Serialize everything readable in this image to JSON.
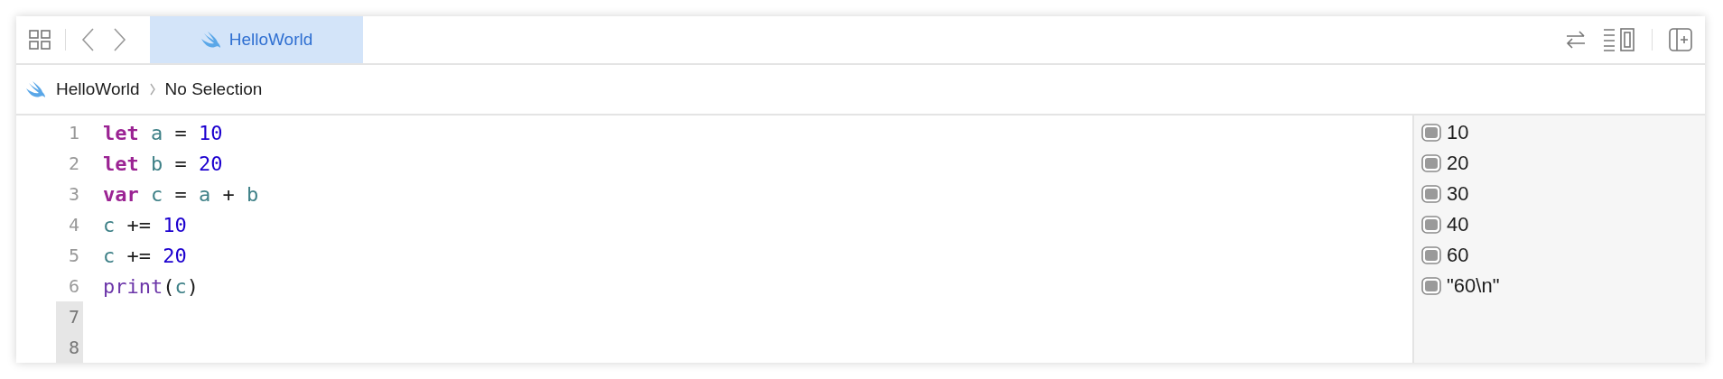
{
  "tab_bar": {
    "tabs": [
      {
        "label": "HelloWorld",
        "selected": true
      }
    ]
  },
  "breadcrumb": {
    "file": "HelloWorld",
    "selection": "No Selection"
  },
  "editor": {
    "lines": [
      {
        "number": "1",
        "highlighted": false,
        "tokens": [
          {
            "kind": "keyword",
            "text": "let"
          },
          {
            "kind": "identifier",
            "text": "a"
          },
          {
            "kind": "plain",
            "text": "="
          },
          {
            "kind": "number",
            "text": "10"
          }
        ]
      },
      {
        "number": "2",
        "highlighted": false,
        "tokens": [
          {
            "kind": "keyword",
            "text": "let"
          },
          {
            "kind": "identifier",
            "text": "b"
          },
          {
            "kind": "plain",
            "text": "="
          },
          {
            "kind": "number",
            "text": "20"
          }
        ]
      },
      {
        "number": "3",
        "highlighted": false,
        "tokens": [
          {
            "kind": "keyword",
            "text": "var"
          },
          {
            "kind": "identifier",
            "text": "c"
          },
          {
            "kind": "plain",
            "text": "="
          },
          {
            "kind": "identifier",
            "text": "a"
          },
          {
            "kind": "plain",
            "text": "+"
          },
          {
            "kind": "identifier",
            "text": "b"
          }
        ]
      },
      {
        "number": "4",
        "highlighted": false,
        "tokens": [
          {
            "kind": "identifier",
            "text": "c"
          },
          {
            "kind": "plain",
            "text": "+="
          },
          {
            "kind": "number",
            "text": "10"
          }
        ]
      },
      {
        "number": "5",
        "highlighted": false,
        "tokens": [
          {
            "kind": "identifier",
            "text": "c"
          },
          {
            "kind": "plain",
            "text": "+="
          },
          {
            "kind": "number",
            "text": "20"
          }
        ]
      },
      {
        "number": "6",
        "highlighted": false,
        "tokens": [
          {
            "kind": "function",
            "text": "print"
          },
          {
            "kind": "plain",
            "text": "("
          },
          {
            "kind": "identifier",
            "text": "c"
          },
          {
            "kind": "plain",
            "text": ")"
          }
        ]
      },
      {
        "number": "7",
        "highlighted": true
      },
      {
        "number": "8",
        "highlighted": true
      }
    ]
  },
  "results": [
    "10",
    "20",
    "30",
    "40",
    "60",
    "\"60\\n\""
  ]
}
